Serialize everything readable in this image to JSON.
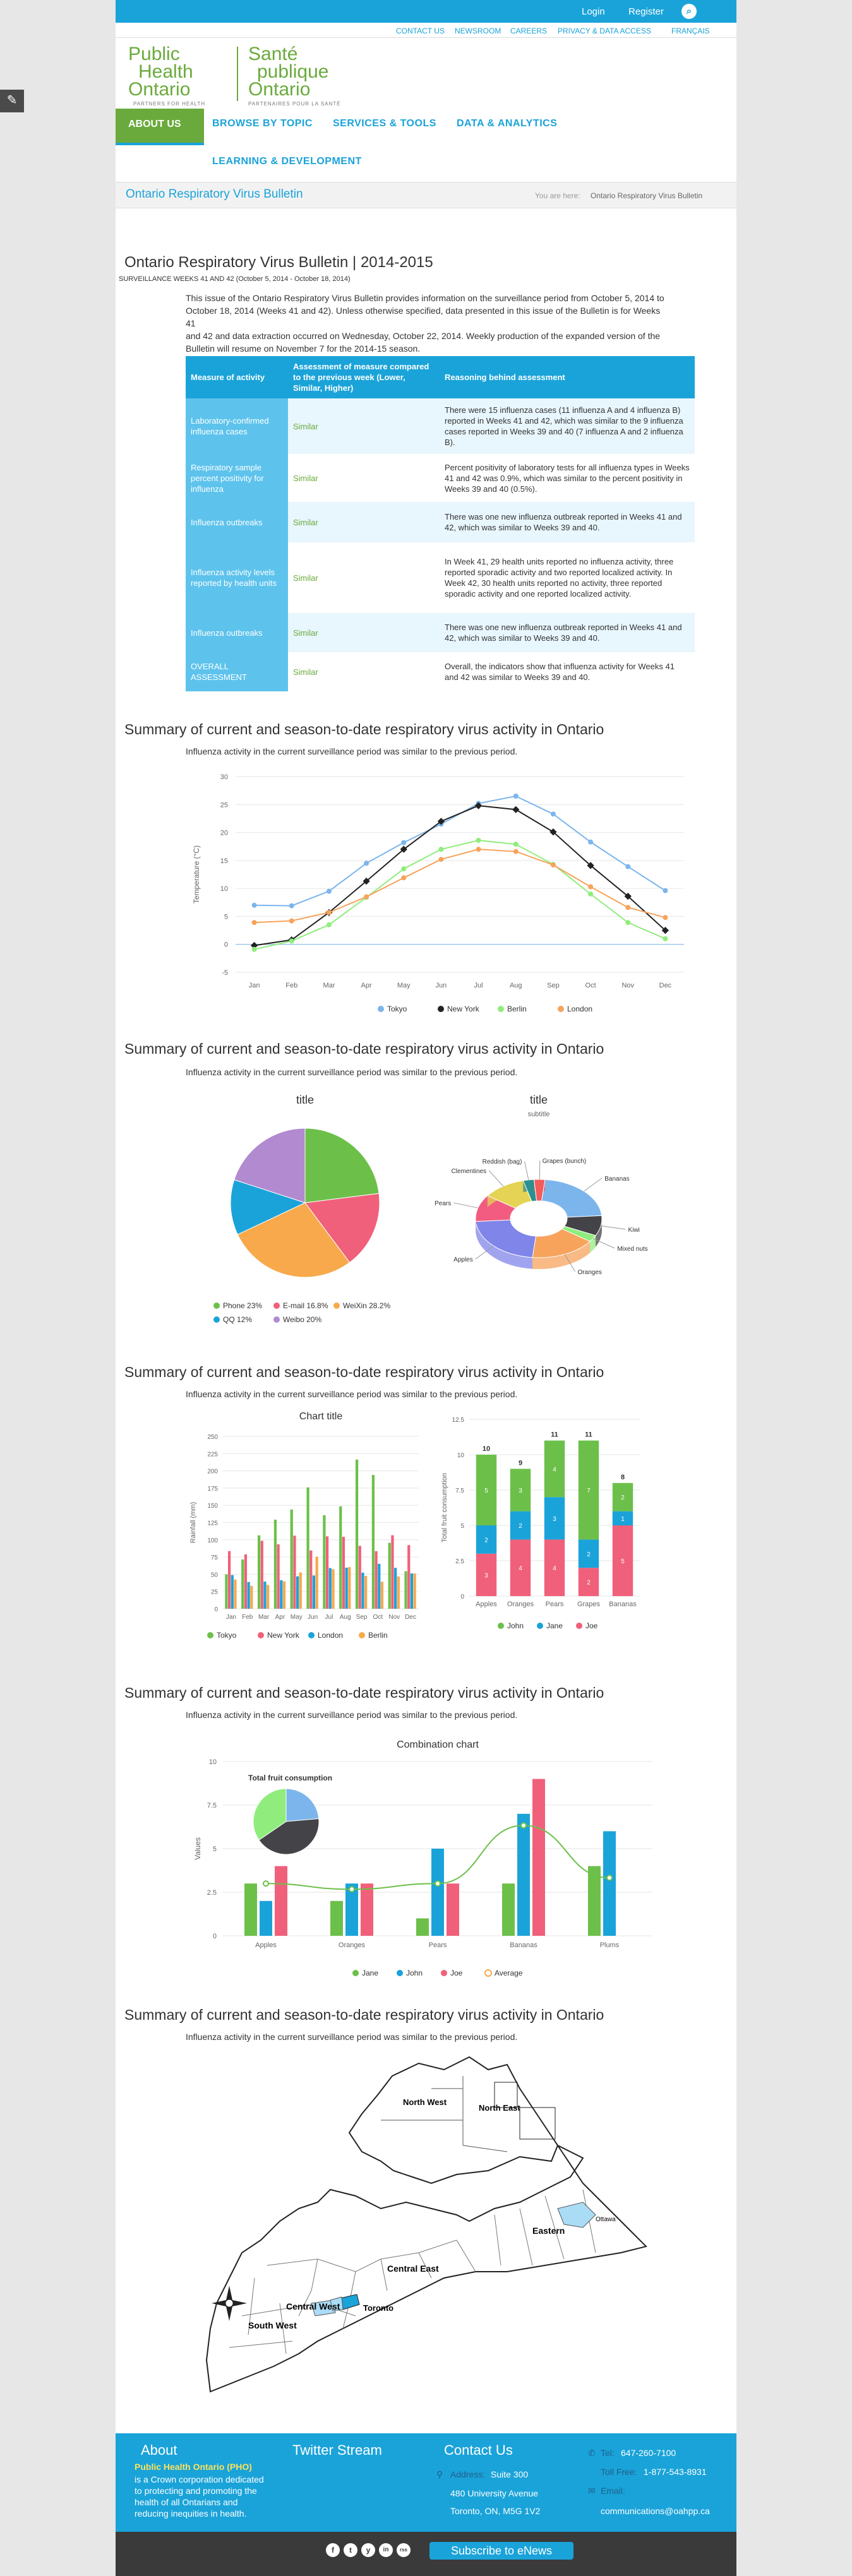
{
  "header": {
    "login": "Login",
    "register": "Register",
    "util_links": [
      "CONTACT US",
      "NEWSROOM",
      "CAREERS",
      "PRIVACY & DATA ACCESS",
      "FRANÇAIS"
    ],
    "logo_en": [
      "Public",
      "Health",
      "Ontario"
    ],
    "logo_en_sub": "PARTNERS FOR HEALTH",
    "logo_fr": [
      "Santé",
      "publique",
      "Ontario"
    ],
    "logo_fr_sub": "PARTENAIRES POUR LA SANTÉ"
  },
  "nav": {
    "items": [
      "ABOUT US",
      "BROWSE BY TOPIC",
      "SERVICES & TOOLS",
      "DATA & ANALYTICS",
      "LEARNING & DEVELOPMENT"
    ]
  },
  "breadcrumb": {
    "title": "Ontario Respiratory Virus Bulletin",
    "you_are_here": "You are here:",
    "current": "Ontario Respiratory Virus Bulletin"
  },
  "bulletin": {
    "title": "Ontario Respiratory Virus Bulletin | 2014-2015",
    "subtitle": "SURVEILLANCE WEEKS 41 AND 42 (October 5, 2014 - October 18, 2014)",
    "intro_lines": [
      "This issue of the Ontario Respiratory Virus Bulletin provides information on the surveillance period from October 5, 2014 to",
      "October 18, 2014 (Weeks 41 and 42). Unless otherwise specified, data presented in this issue of the Bulletin is for Weeks 41",
      "and 42 and data extraction occurred on Wednesday, October 22, 2014. Weekly production of the expanded version of the",
      "Bulletin will resume on November 7 for the 2014-15 season."
    ]
  },
  "table": {
    "headers": [
      "Measure of activity",
      "Assessment of measure compared to the previous week (Lower, Similar, Higher)",
      "Reasoning behind assessment"
    ],
    "rows": [
      [
        "Laboratory-confirmed influenza cases",
        "Similar",
        "There were 15 influenza cases (11 influenza A and 4 influenza B) reported in Weeks 41 and 42, which was similar to the 9 influenza cases reported in Weeks 39 and 40 (7 influenza A and 2 influenza B)."
      ],
      [
        "Respiratory sample percent positivity for influenza",
        "Similar",
        "Percent positivity of laboratory tests for all influenza types in Weeks 41 and 42 was 0.9%, which was similar to the percent positivity in Weeks 39 and 40 (0.5%)."
      ],
      [
        "Influenza outbreaks",
        "Similar",
        "There was one new influenza outbreak reported in Weeks 41 and 42, which was similar to Weeks 39 and 40."
      ],
      [
        "Influenza activity levels reported by health units",
        "Similar",
        "In Week 41, 29 health units reported no influenza activity, three reported sporadic activity and two reported localized activity. In Week 42, 30 health units reported no activity, three reported sporadic activity and one reported localized activity."
      ],
      [
        "Influenza outbreaks",
        "Similar",
        "There was one new influenza outbreak reported in Weeks 41 and 42, which was similar to Weeks 39 and 40."
      ],
      [
        "OVERALL ASSESSMENT",
        "Similar",
        "Overall, the indicators show that influenza activity for Weeks 41 and 42 was similar to Weeks 39 and 40."
      ]
    ]
  },
  "sections": [
    {
      "title": "Summary of current and season-to-date respiratory virus activity in Ontario",
      "text": "Influenza activity in the current surveillance period was similar to the previous period."
    },
    {
      "title": "Summary of current and season-to-date respiratory virus activity in Ontario",
      "text": "Influenza activity in the current surveillance period was similar to the previous period."
    },
    {
      "title": "Summary of current and season-to-date respiratory virus activity in Ontario",
      "text": "Influenza activity in the current surveillance period was similar to the previous period."
    },
    {
      "title": "Summary of current and season-to-date respiratory virus activity in Ontario",
      "text": "Influenza activity in the current surveillance period was similar to the previous period."
    },
    {
      "title": "Summary of current and season-to-date respiratory virus activity in Ontario",
      "text": "Influenza activity in the current surveillance period was similar to the previous period."
    }
  ],
  "chart_data": [
    {
      "type": "line",
      "x": [
        "Jan",
        "Feb",
        "Mar",
        "Apr",
        "May",
        "Jun",
        "Jul",
        "Aug",
        "Sep",
        "Oct",
        "Nov",
        "Dec"
      ],
      "ylabel": "Temperature (°C)",
      "ylim": [
        -5,
        30
      ],
      "yticks": [
        -5,
        0,
        5,
        10,
        15,
        20,
        25,
        30
      ],
      "series": [
        {
          "name": "Tokyo",
          "color": "#7cb5ec",
          "values": [
            7,
            6.9,
            9.5,
            14.5,
            18.2,
            21.5,
            25.2,
            26.5,
            23.3,
            18.3,
            13.9,
            9.6
          ]
        },
        {
          "name": "New York",
          "color": "#222222",
          "values": [
            -0.2,
            0.8,
            5.7,
            11.3,
            17,
            22,
            24.8,
            24.1,
            20.1,
            14.1,
            8.6,
            2.5
          ]
        },
        {
          "name": "Berlin",
          "color": "#90ed7d",
          "values": [
            -0.9,
            0.6,
            3.5,
            8.4,
            13.5,
            17,
            18.6,
            17.9,
            14.3,
            9,
            3.9,
            1
          ]
        },
        {
          "name": "London",
          "color": "#f7a35c",
          "values": [
            3.9,
            4.2,
            5.7,
            8.5,
            11.9,
            15.2,
            17,
            16.6,
            14.2,
            10.3,
            6.6,
            4.8
          ]
        }
      ]
    },
    {
      "type": "pie",
      "title": "title",
      "slices": [
        {
          "name": "Phone",
          "label": "Phone 23%",
          "value": 23,
          "color": "#6cc04a"
        },
        {
          "name": "E-mail",
          "label": "E-mail 16.8%",
          "value": 16.8,
          "color": "#f0607a"
        },
        {
          "name": "WeiXin",
          "label": "WeiXin 28.2%",
          "value": 28.2,
          "color": "#f7a94b"
        },
        {
          "name": "QQ",
          "label": "QQ 12%",
          "value": 12,
          "color": "#1aa3d9"
        },
        {
          "name": "Weibo",
          "label": "Weibo 20%",
          "value": 20,
          "color": "#b28ad0"
        }
      ]
    },
    {
      "type": "pie",
      "title": "title",
      "subtitle": "subtitle",
      "slices": [
        {
          "name": "Bananas",
          "value": 8,
          "color": "#7cb5ec"
        },
        {
          "name": "Kiwi",
          "value": 3,
          "color": "#434348"
        },
        {
          "name": "Mixed nuts",
          "value": 1,
          "color": "#90ed7d"
        },
        {
          "name": "Oranges",
          "value": 6,
          "color": "#f7a35c"
        },
        {
          "name": "Apples",
          "value": 8,
          "color": "#8085e9"
        },
        {
          "name": "Pears",
          "value": 4,
          "color": "#f15c80"
        },
        {
          "name": "Clementines",
          "value": 4,
          "color": "#e4d354"
        },
        {
          "name": "Reddish (bag)",
          "value": 1,
          "color": "#2b908f"
        },
        {
          "name": "Grapes (bunch)",
          "value": 1,
          "color": "#f45b5b"
        }
      ]
    },
    {
      "type": "bar",
      "title": "Chart title",
      "categories": [
        "Jan",
        "Feb",
        "Mar",
        "Apr",
        "May",
        "Jun",
        "Jul",
        "Aug",
        "Sep",
        "Oct",
        "Nov",
        "Dec"
      ],
      "ylabel": "Rainfall (mm)",
      "ylim": [
        0,
        250
      ],
      "yticks": [
        0,
        25,
        50,
        75,
        100,
        125,
        150,
        175,
        200,
        225,
        250
      ],
      "series": [
        {
          "name": "Tokyo",
          "color": "#6cc04a",
          "values": [
            49.9,
            71.5,
            106.4,
            129.2,
            144,
            176,
            135.6,
            148.5,
            216.4,
            194.1,
            95.6,
            54.4
          ]
        },
        {
          "name": "New York",
          "color": "#f0607a",
          "values": [
            83.6,
            78.8,
            98.5,
            93.4,
            106,
            84.5,
            105,
            104.3,
            91.2,
            83.5,
            106.6,
            92.3
          ]
        },
        {
          "name": "London",
          "color": "#1aa3d9",
          "values": [
            48.9,
            38.8,
            39.3,
            41.4,
            47,
            48.3,
            59,
            59.6,
            52.4,
            65.2,
            59.3,
            51.2
          ]
        },
        {
          "name": "Berlin",
          "color": "#f7a94b",
          "values": [
            42.4,
            33.2,
            34.5,
            39.7,
            52.6,
            75.5,
            57.4,
            60.4,
            47.6,
            39.1,
            46.8,
            51.1
          ]
        }
      ]
    },
    {
      "type": "bar",
      "stacked": true,
      "categories": [
        "Apples",
        "Oranges",
        "Pears",
        "Grapes",
        "Bananas"
      ],
      "ylabel": "Total fruit consumption",
      "ylim": [
        0,
        12.5
      ],
      "yticks": [
        0,
        2.5,
        5,
        7.5,
        10,
        12.5
      ],
      "totals": [
        10,
        9,
        11,
        11,
        8
      ],
      "series": [
        {
          "name": "John",
          "color": "#6cc04a",
          "values": [
            5,
            3,
            4,
            7,
            2
          ]
        },
        {
          "name": "Jane",
          "color": "#1aa3d9",
          "values": [
            2,
            2,
            3,
            2,
            1
          ]
        },
        {
          "name": "Joe",
          "color": "#f0607a",
          "values": [
            3,
            4,
            4,
            2,
            5
          ]
        }
      ]
    },
    {
      "type": "bar",
      "title": "Combination chart",
      "categories": [
        "Apples",
        "Oranges",
        "Pears",
        "Bananas",
        "Plums"
      ],
      "ylabel": "Values",
      "ylim": [
        0,
        10
      ],
      "yticks": [
        0,
        2.5,
        5,
        7.5,
        10
      ],
      "series": [
        {
          "name": "Jane",
          "color": "#6cc04a",
          "values": [
            3,
            2,
            1,
            3,
            4
          ]
        },
        {
          "name": "John",
          "color": "#1aa3d9",
          "values": [
            2,
            3,
            5,
            7,
            6
          ]
        },
        {
          "name": "Joe",
          "color": "#f0607a",
          "values": [
            4,
            3,
            3,
            9,
            0
          ]
        },
        {
          "name": "Average",
          "type": "line",
          "color": "#6cc04a",
          "values": [
            3,
            2.67,
            3,
            6.33,
            3.33
          ]
        }
      ],
      "inset_pie": {
        "title": "Total fruit consumption",
        "slices": [
          {
            "name": "Jane",
            "value": 13,
            "color": "#7cb5ec"
          },
          {
            "name": "John",
            "value": 23,
            "color": "#434348"
          },
          {
            "name": "Joe",
            "value": 19,
            "color": "#90ed7d"
          }
        ]
      }
    }
  ],
  "map": {
    "labels": [
      "North West",
      "North East",
      "Central East",
      "Eastern",
      "Central West",
      "Toronto",
      "South West",
      "Ottawa"
    ]
  },
  "footer": {
    "about_h": "About",
    "about_org": "Public Health Ontario (PHO)",
    "about_text": [
      "is a Crown corporation dedicated",
      "to protecting and promoting the",
      "health of all Ontarians and",
      "reducing inequities in health."
    ],
    "twitter_h": "Twitter Stream",
    "contact_h": "Contact Us",
    "address_label": "Address:",
    "address": [
      "Suite 300",
      "480 University Avenue",
      "Toronto, ON, M5G 1V2"
    ],
    "tel_label": "Tel:",
    "tel": "647-260-7100",
    "tollfree_label": "Toll Free:",
    "tollfree": "1-877-543-8931",
    "email_label": "Email:",
    "email": "communications@oahpp.ca",
    "social": [
      "f",
      "t",
      "y",
      "in",
      "rss"
    ],
    "subscribe": "Subscribe to eNews"
  }
}
